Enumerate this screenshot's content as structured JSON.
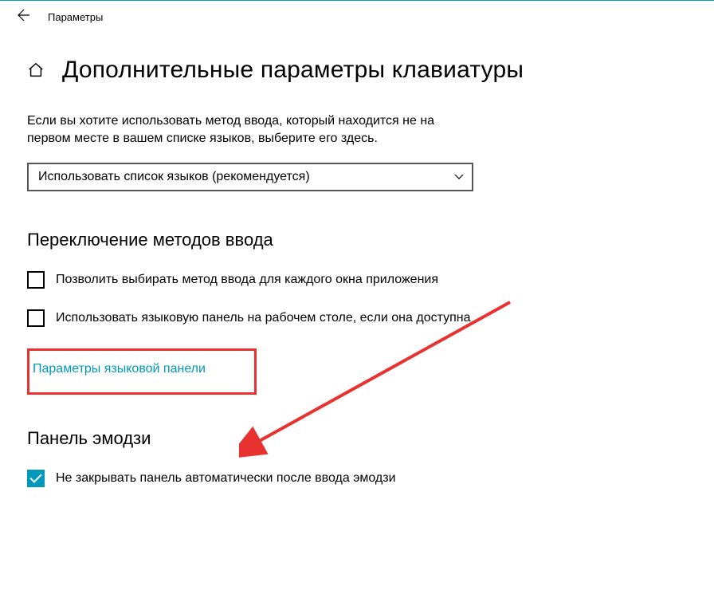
{
  "window": {
    "title": "Параметры"
  },
  "page": {
    "heading": "Дополнительные параметры клавиатуры",
    "description": "Если вы хотите использовать метод ввода, который находится не на первом месте в вашем списке языков, выберите его здесь."
  },
  "combo": {
    "selected": "Использовать список языков (рекомендуется)"
  },
  "sections": {
    "switching": {
      "title": "Переключение методов ввода",
      "checkbox1": "Позволить выбирать метод ввода для каждого окна приложения",
      "checkbox2": "Использовать языковую панель на рабочем столе, если она доступна",
      "link": "Параметры языковой панели"
    },
    "emoji": {
      "title": "Панель эмодзи",
      "checkbox": "Не закрывать панель автоматически после ввода эмодзи"
    }
  },
  "annotation": {
    "color": "#e8322f"
  }
}
